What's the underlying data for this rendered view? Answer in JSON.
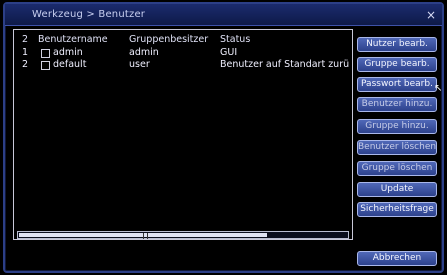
{
  "window": {
    "title": "Werkzeug > Benutzer",
    "close_glyph": "×"
  },
  "table": {
    "headers": {
      "num": "2",
      "name": "Benutzername",
      "group": "Gruppenbesitzer",
      "status": "Status"
    },
    "rows": [
      {
        "num": "1",
        "name": "admin",
        "group": "admin",
        "status": "GUI"
      },
      {
        "num": "2",
        "name": "default",
        "group": "user",
        "status": "Benutzer auf Standart zurü"
      }
    ]
  },
  "buttons": {
    "edit_user": "Nutzer bearb.",
    "edit_group": "Gruppe bearb.",
    "edit_password": "Passwort bearb.",
    "add_user": "Benutzer hinzu.",
    "add_group": "Gruppe hinzu.",
    "delete_user": "Benutzer löschen",
    "delete_group": "Gruppe löschen",
    "update": "Update",
    "security_questions": "Sicherheitsfrage",
    "cancel": "Abbrechen"
  },
  "icons": {
    "cursor": "mouse-pointer-icon"
  }
}
